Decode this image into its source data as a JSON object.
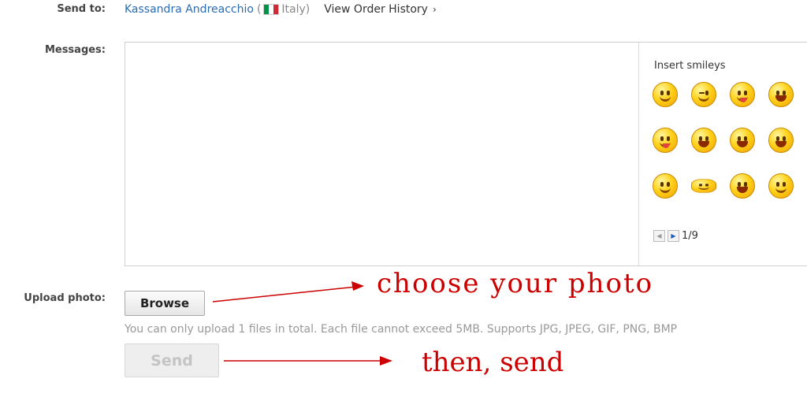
{
  "send_to": {
    "label": "Send to:",
    "recipient": "Kassandra Andreacchio",
    "open_paren": "(",
    "country": "Italy)",
    "view_history": "View Order History",
    "chevron": "›",
    "flag_colors": [
      "#009246",
      "#ffffff",
      "#ce2b37"
    ]
  },
  "messages": {
    "label": "Messages:",
    "value": "",
    "smileys_title": "Insert smileys",
    "smiley_icons": [
      "smile-icon",
      "wink-kiss-icon",
      "tongue-out-icon",
      "giggle-icon",
      "drooling-icon",
      "shouting-icon",
      "laughing-tears-icon",
      "blush-icon",
      "hiding-face-icon",
      "squint-icon",
      "shy-laugh-icon",
      "grin-icon"
    ],
    "pager": {
      "prev": "◀",
      "next": "▶",
      "page_text": "1/9"
    }
  },
  "upload": {
    "label": "Upload photo:",
    "browse_label": "Browse",
    "hint": "You can only upload 1 files in total. Each file cannot exceed 5MB. Supports JPG, JPEG, GIF, PNG, BMP",
    "send_label": "Send"
  },
  "annotations": {
    "choose": "choose your photo",
    "then_send": "then, send",
    "color": "#cc0000"
  }
}
